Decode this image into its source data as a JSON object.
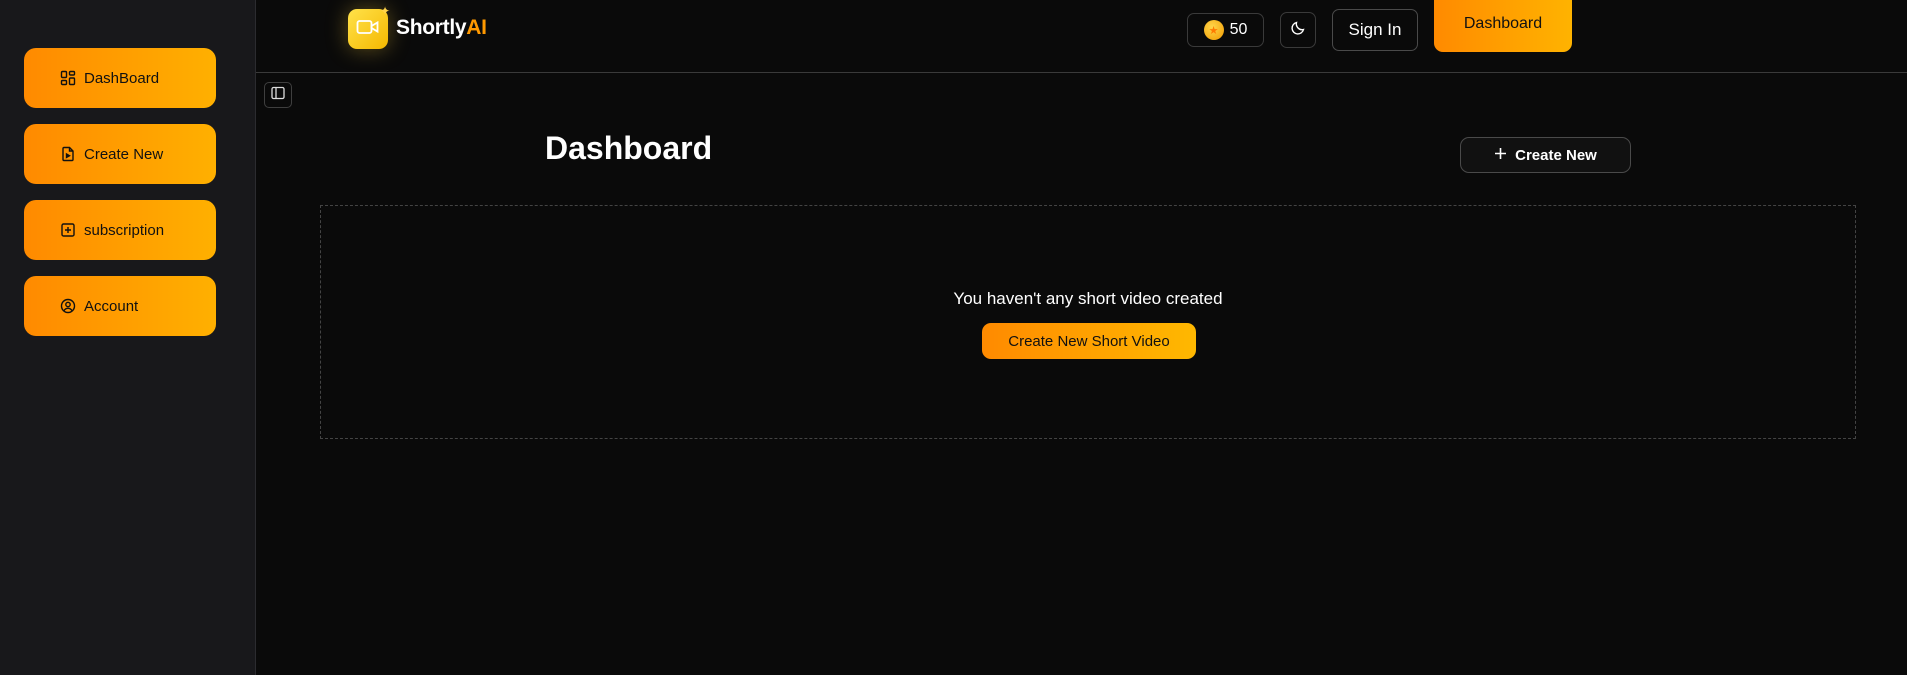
{
  "sidebar": {
    "items": [
      {
        "label": "DashBoard",
        "icon": "layout-grid-icon"
      },
      {
        "label": "Create New",
        "icon": "file-video-icon"
      },
      {
        "label": "subscription",
        "icon": "plus-square-icon"
      },
      {
        "label": "Account",
        "icon": "user-circle-icon"
      }
    ]
  },
  "header": {
    "logo": {
      "brand": "Shortly",
      "accent": "AI",
      "icon": "video-camera-icon"
    },
    "credits": {
      "value": "50",
      "icon": "coin-icon"
    },
    "theme_toggle_icon": "moon-icon",
    "signin_label": "Sign In",
    "dashboard_label": "Dashboard"
  },
  "main": {
    "sidebar_toggle_icon": "panel-left-icon",
    "title": "Dashboard",
    "create_new_label": "Create New",
    "empty_state": {
      "message": "You haven't any short video created",
      "cta_label": "Create New Short Video"
    }
  },
  "colors": {
    "accent_start": "#ff8a00",
    "accent_end": "#ffb300",
    "background": "#0a0a0a",
    "sidebar": "#18181b"
  }
}
